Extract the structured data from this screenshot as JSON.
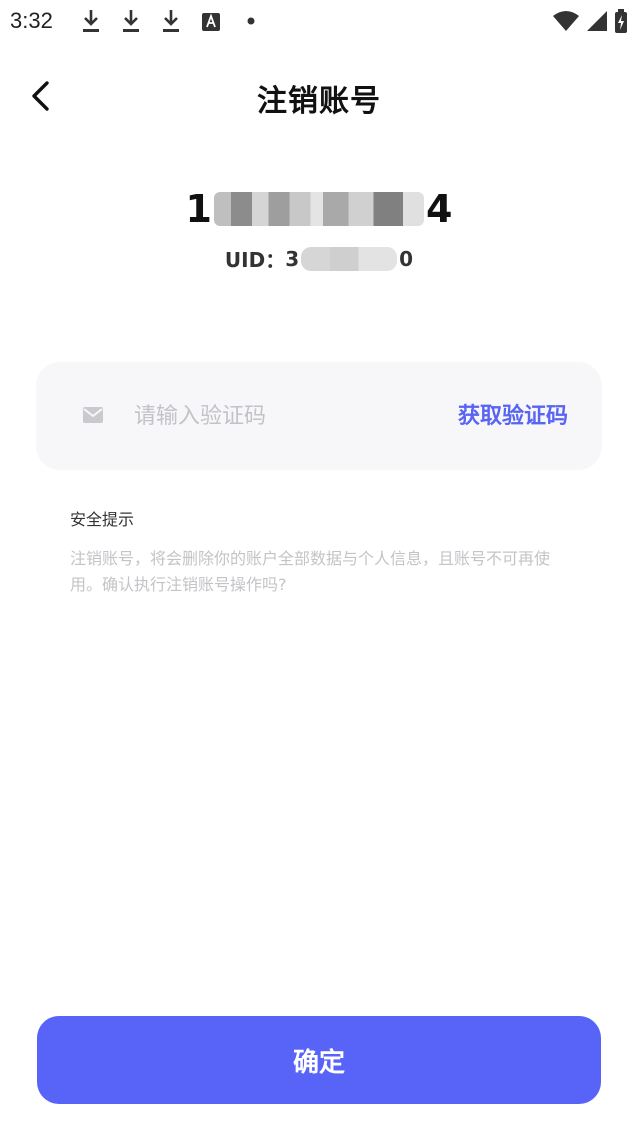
{
  "status_bar": {
    "time": "3:32",
    "icons": [
      "download-icon",
      "download-icon",
      "download-icon",
      "translate-icon",
      "dot-icon",
      "wifi-icon",
      "signal-icon",
      "battery-icon"
    ]
  },
  "header": {
    "title": "注销账号",
    "back_icon": "chevron-left-icon"
  },
  "account": {
    "phone_prefix": "1",
    "phone_suffix": "4",
    "uid_label": "UID：",
    "uid_prefix": "3",
    "uid_suffix": "0"
  },
  "verification": {
    "icon": "mail-icon",
    "placeholder": "请输入验证码",
    "value": "",
    "get_code_label": "获取验证码"
  },
  "notice": {
    "title": "安全提示",
    "text": "注销账号，将会删除你的账户全部数据与个人信息，且账号不可再使用。确认执行注销账号操作吗?"
  },
  "footer": {
    "confirm_label": "确定"
  },
  "colors": {
    "accent": "#5864F8",
    "link": "#5864F2",
    "card_bg": "#F7F7F9",
    "muted_text": "#C4C4C8"
  }
}
